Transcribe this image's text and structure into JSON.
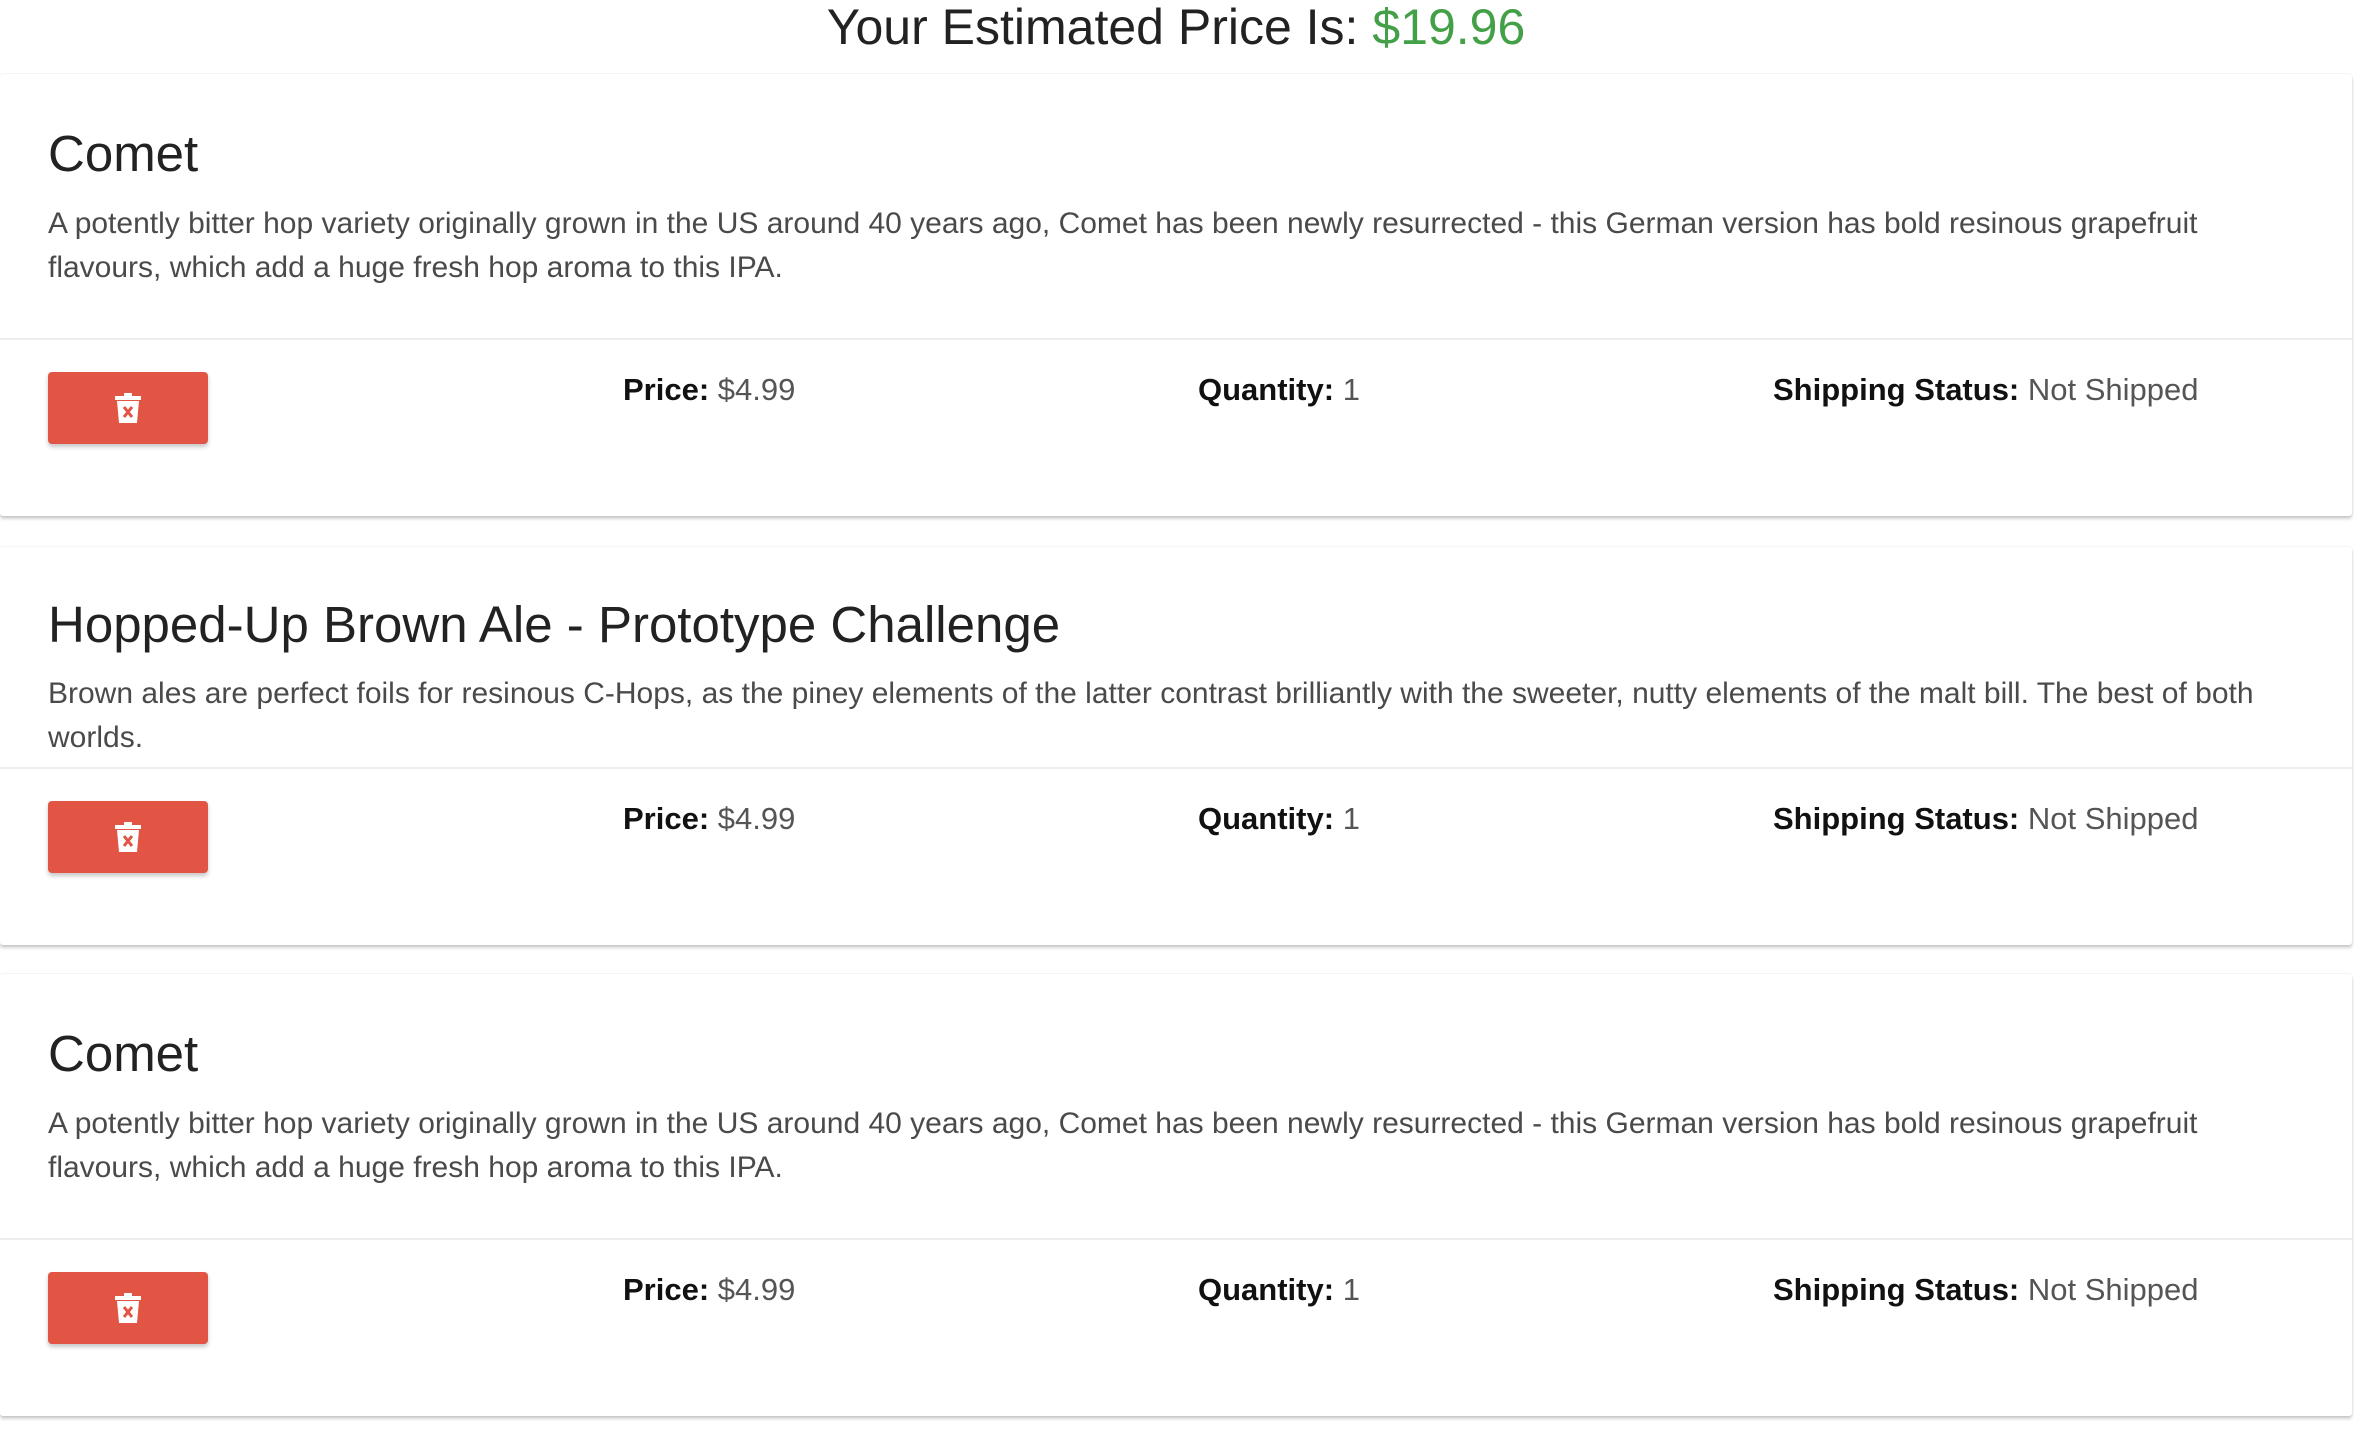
{
  "header": {
    "label": "Your Estimated Price Is:",
    "price": "$19.96"
  },
  "cart": {
    "items": [
      {
        "title": "Comet",
        "description": "A potently bitter hop variety originally grown in the US around 40 years ago, Comet has been newly resurrected - this German version has bold resinous grapefruit flavours, which add a huge fresh hop aroma to this IPA.",
        "price_label": "Price:",
        "price": "$4.99",
        "quantity_label": "Quantity:",
        "quantity": "1",
        "shipping_label": "Shipping Status:",
        "shipping": "Not Shipped",
        "delete_icon": "trash-icon"
      },
      {
        "title": "Hopped-Up Brown Ale - Prototype Challenge",
        "description": "Brown ales are perfect foils for resinous C-Hops, as the piney elements of the latter contrast brilliantly with the sweeter, nutty elements of the malt bill. The best of both worlds.",
        "price_label": "Price:",
        "price": "$4.99",
        "quantity_label": "Quantity:",
        "quantity": "1",
        "shipping_label": "Shipping Status:",
        "shipping": "Not Shipped",
        "delete_icon": "trash-icon"
      },
      {
        "title": "Comet",
        "description": "A potently bitter hop variety originally grown in the US around 40 years ago, Comet has been newly resurrected - this German version has bold resinous grapefruit flavours, which add a huge fresh hop aroma to this IPA.",
        "price_label": "Price:",
        "price": "$4.99",
        "quantity_label": "Quantity:",
        "quantity": "1",
        "shipping_label": "Shipping Status:",
        "shipping": "Not Shipped",
        "delete_icon": "trash-icon"
      }
    ]
  },
  "colors": {
    "price_accent": "#43a047",
    "delete_button": "#e25443"
  }
}
